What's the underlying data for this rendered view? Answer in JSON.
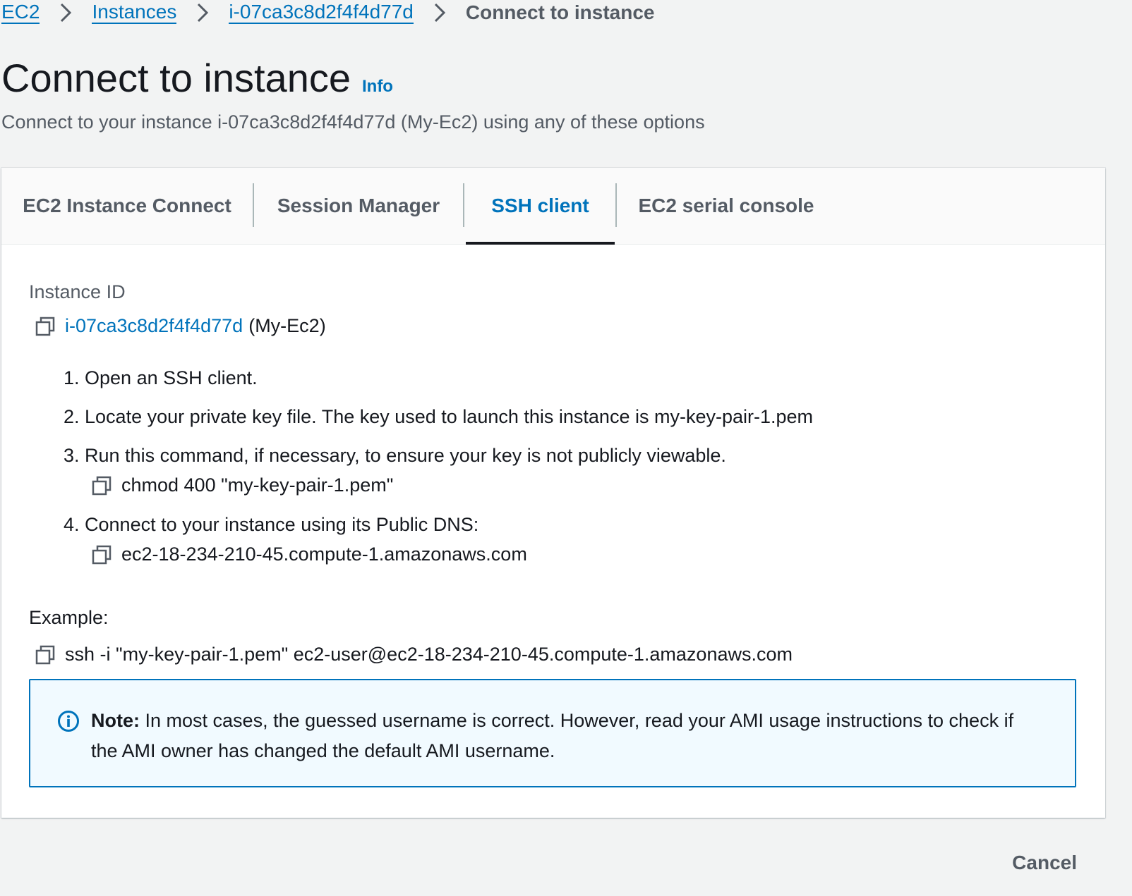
{
  "breadcrumb": {
    "items": [
      {
        "label": "EC2"
      },
      {
        "label": "Instances"
      },
      {
        "label": "i-07ca3c8d2f4f4d77d"
      }
    ],
    "current": "Connect to instance"
  },
  "header": {
    "title": "Connect to instance",
    "info_label": "Info",
    "subtitle": "Connect to your instance i-07ca3c8d2f4f4d77d (My-Ec2) using any of these options"
  },
  "tabs": [
    {
      "label": "EC2 Instance Connect",
      "active": false
    },
    {
      "label": "Session Manager",
      "active": false
    },
    {
      "label": "SSH client",
      "active": true
    },
    {
      "label": "EC2 serial console",
      "active": false
    }
  ],
  "instance": {
    "label": "Instance ID",
    "id": "i-07ca3c8d2f4f4d77d",
    "name": "(My-Ec2)"
  },
  "steps": [
    {
      "text": "1. Open an SSH client."
    },
    {
      "text": "2. Locate your private key file. The key used to launch this instance is my-key-pair-1.pem"
    },
    {
      "text": "3. Run this command, if necessary, to ensure your key is not publicly viewable.",
      "command": "chmod 400 \"my-key-pair-1.pem\""
    },
    {
      "text": "4. Connect to your instance using its Public DNS:",
      "command": "ec2-18-234-210-45.compute-1.amazonaws.com"
    }
  ],
  "example": {
    "label": "Example:",
    "command": "ssh -i \"my-key-pair-1.pem\" ec2-user@ec2-18-234-210-45.compute-1.amazonaws.com"
  },
  "note": {
    "label": "Note:",
    "text": " In most cases, the guessed username is correct. However, read your AMI usage instructions to check if the AMI owner has changed the default AMI username."
  },
  "footer": {
    "cancel_label": "Cancel"
  },
  "icons": {
    "breadcrumb_separator": "chevron-right-icon",
    "copy": "copy-icon",
    "info": "info-circle-icon"
  },
  "colors": {
    "link": "#0073bb",
    "active_tab_underline": "#16191f",
    "page_background": "#f2f3f3",
    "alert_background": "#f1faff",
    "alert_border": "#0073bb"
  }
}
